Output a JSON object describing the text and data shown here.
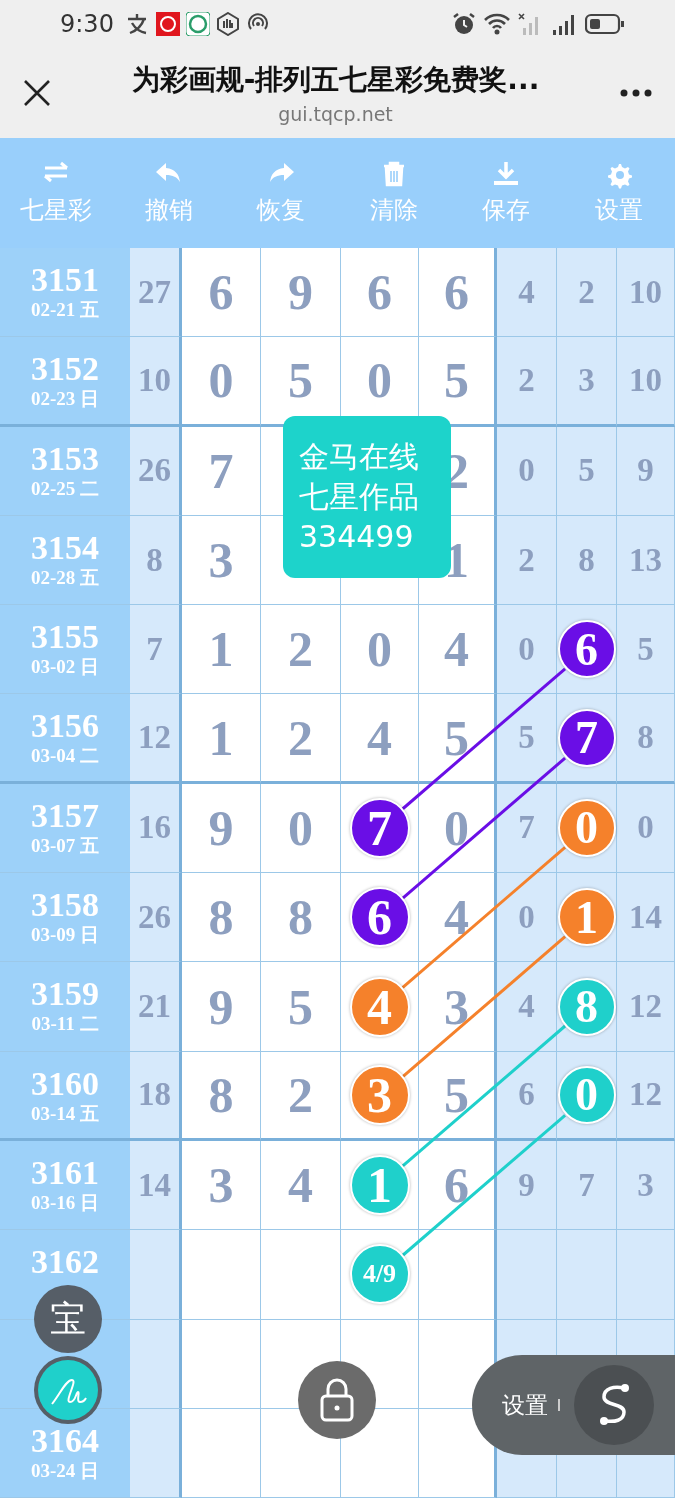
{
  "status_bar": {
    "time": "9:30"
  },
  "header": {
    "title": "为彩画规-排列五七星彩免费奖...",
    "url": "gui.tqcp.net"
  },
  "toolbar": [
    {
      "label": "七星彩"
    },
    {
      "label": "撤销"
    },
    {
      "label": "恢复"
    },
    {
      "label": "清除"
    },
    {
      "label": "保存"
    },
    {
      "label": "设置"
    }
  ],
  "rows": [
    {
      "issue": "3151",
      "date": "02-21 五",
      "cells": [
        {
          "text": "27"
        },
        {
          "text": "6"
        },
        {
          "text": "9"
        },
        {
          "text": "6"
        },
        {
          "text": "6"
        },
        {
          "text": "4"
        },
        {
          "text": "2"
        },
        {
          "text": "10"
        }
      ]
    },
    {
      "issue": "3152",
      "date": "02-23 日",
      "cells": [
        {
          "text": "10"
        },
        {
          "text": "0"
        },
        {
          "text": "5"
        },
        {
          "text": "0"
        },
        {
          "text": "5"
        },
        {
          "text": "2"
        },
        {
          "text": "3"
        },
        {
          "text": "10"
        }
      ]
    },
    {
      "issue": "3153",
      "date": "02-25 二",
      "cells": [
        {
          "text": "26"
        },
        {
          "text": "7"
        },
        null,
        null,
        {
          "text": "2"
        },
        {
          "text": "0"
        },
        {
          "text": "5"
        },
        {
          "text": "9"
        }
      ]
    },
    {
      "issue": "3154",
      "date": "02-28 五",
      "cells": [
        {
          "text": "8"
        },
        {
          "text": "3"
        },
        null,
        null,
        {
          "text": "1"
        },
        {
          "text": "2"
        },
        {
          "text": "8"
        },
        {
          "text": "13"
        }
      ]
    },
    {
      "issue": "3155",
      "date": "03-02 日",
      "cells": [
        {
          "text": "7"
        },
        {
          "text": "1"
        },
        {
          "text": "2"
        },
        {
          "text": "0"
        },
        {
          "text": "4"
        },
        {
          "text": "0"
        },
        {
          "text": "6",
          "color": "#6a0ee6"
        },
        {
          "text": "5"
        }
      ]
    },
    {
      "issue": "3156",
      "date": "03-04 二",
      "cells": [
        {
          "text": "12"
        },
        {
          "text": "1"
        },
        {
          "text": "2"
        },
        {
          "text": "4"
        },
        {
          "text": "5"
        },
        {
          "text": "5"
        },
        {
          "text": "7",
          "color": "#6a0ee6"
        },
        {
          "text": "8"
        }
      ]
    },
    {
      "issue": "3157",
      "date": "03-07 五",
      "cells": [
        {
          "text": "16"
        },
        {
          "text": "9"
        },
        {
          "text": "0"
        },
        {
          "text": "7",
          "color": "#6a0ee6"
        },
        {
          "text": "0"
        },
        {
          "text": "7"
        },
        {
          "text": "0",
          "color": "#f5812b"
        },
        {
          "text": "0"
        }
      ]
    },
    {
      "issue": "3158",
      "date": "03-09 日",
      "cells": [
        {
          "text": "26"
        },
        {
          "text": "8"
        },
        {
          "text": "8"
        },
        {
          "text": "6",
          "color": "#6a0ee6"
        },
        {
          "text": "4"
        },
        {
          "text": "0"
        },
        {
          "text": "1",
          "color": "#f5812b"
        },
        {
          "text": "14"
        }
      ]
    },
    {
      "issue": "3159",
      "date": "03-11 二",
      "cells": [
        {
          "text": "21"
        },
        {
          "text": "9"
        },
        {
          "text": "5"
        },
        {
          "text": "4",
          "color": "#f5812b"
        },
        {
          "text": "3"
        },
        {
          "text": "4"
        },
        {
          "text": "8",
          "color": "#1fd0cb"
        },
        {
          "text": "12"
        }
      ]
    },
    {
      "issue": "3160",
      "date": "03-14 五",
      "cells": [
        {
          "text": "18"
        },
        {
          "text": "8"
        },
        {
          "text": "2"
        },
        {
          "text": "3",
          "color": "#f5812b"
        },
        {
          "text": "5"
        },
        {
          "text": "6"
        },
        {
          "text": "0",
          "color": "#1fd0cb"
        },
        {
          "text": "12"
        }
      ]
    },
    {
      "issue": "3161",
      "date": "03-16 日",
      "cells": [
        {
          "text": "14"
        },
        {
          "text": "3"
        },
        {
          "text": "4"
        },
        {
          "text": "1",
          "color": "#1fd0cb"
        },
        {
          "text": "6"
        },
        {
          "text": "9"
        },
        {
          "text": "7"
        },
        {
          "text": "3"
        }
      ]
    },
    {
      "issue": "3162",
      "cells": [
        null,
        null,
        null,
        {
          "text": "4/9",
          "color": "#1fd0cb"
        },
        null,
        null,
        null,
        null
      ]
    },
    {
      "cells": [
        null,
        null,
        null,
        null,
        null,
        null,
        null,
        null
      ]
    },
    {
      "issue": "3164",
      "date": "03-24 日",
      "cells": [
        null,
        null,
        null,
        null,
        null,
        null,
        null,
        null
      ]
    }
  ],
  "note": {
    "lines": [
      "金马在线",
      "七星作品",
      "334499"
    ]
  },
  "floating": {
    "treasure_label": "宝",
    "panel_label": "设置"
  }
}
